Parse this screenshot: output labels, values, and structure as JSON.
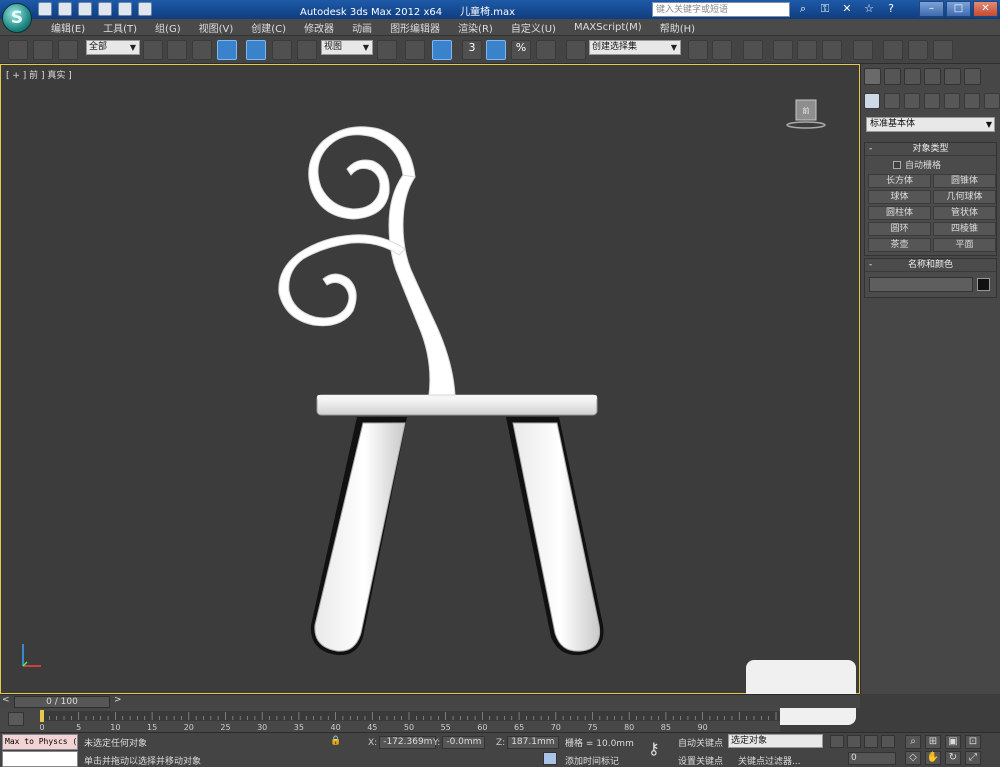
{
  "app": {
    "logo": "S",
    "title": "Autodesk 3ds Max  2012 x64",
    "filename": "儿童椅.max",
    "search_placeholder": "键入关键字或短语"
  },
  "menu": [
    "编辑(E)",
    "工具(T)",
    "组(G)",
    "视图(V)",
    "创建(C)",
    "修改器",
    "动画",
    "图形编辑器",
    "渲染(R)",
    "自定义(U)",
    "MAXScript(M)",
    "帮助(H)"
  ],
  "toolbar": {
    "selection_filter": "全部",
    "ref_coord": "视图",
    "named_selection": "创建选择集",
    "snap_label": "3",
    "percent_label": "%"
  },
  "viewport": {
    "label": "[ + ] 前 ] 真实 ]",
    "viewcube_label": "前"
  },
  "command_panel": {
    "category": "标准基本体",
    "object_type_header": "对象类型",
    "autogrid": "自动栅格",
    "objects": [
      "长方体",
      "圆锥体",
      "球体",
      "几何球体",
      "圆柱体",
      "管状体",
      "圆环",
      "四棱锥",
      "茶壶",
      "平面"
    ],
    "name_color_header": "名称和颜色"
  },
  "timeline": {
    "frame_display": "0 / 100",
    "prev": "<",
    "next": ">",
    "ticks": [
      0,
      5,
      10,
      15,
      20,
      25,
      30,
      35,
      40,
      45,
      50,
      55,
      60,
      65,
      70,
      75,
      80,
      85,
      90
    ]
  },
  "status": {
    "maxscript_listener": "Max to Physcs (",
    "maxscript_mini": "",
    "selection": "未选定任何对象",
    "prompt": "单击并拖动以选择并移动对象",
    "x_label": "X:",
    "x_value": "-172.369m",
    "y_label": "Y:",
    "y_value": "-0.0mm",
    "z_label": "Z:",
    "z_value": "187.1mm",
    "grid": "栅格 = 10.0mm",
    "add_time_tag": "添加时间标记",
    "auto_key": "自动关键点",
    "set_key": "设置关键点",
    "selected_objects": "选定对象",
    "key_filters": "关键点过滤器...",
    "current_frame": "0"
  }
}
